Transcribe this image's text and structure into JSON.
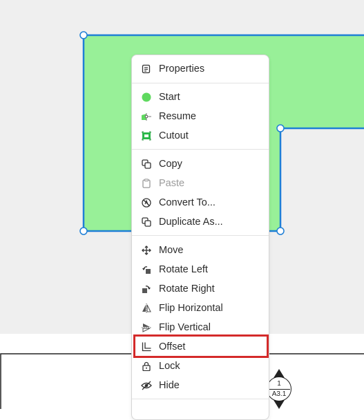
{
  "colors": {
    "shape_fill": "#98f098",
    "shape_stroke": "#1e7fd6",
    "highlight": "#d42a2a",
    "canvas_bg": "#efefef"
  },
  "context_menu": {
    "items": [
      {
        "id": "properties",
        "label": "Properties",
        "icon": "properties-icon",
        "enabled": true
      },
      {
        "id": "start",
        "label": "Start",
        "icon": "start-icon",
        "enabled": true
      },
      {
        "id": "resume",
        "label": "Resume",
        "icon": "resume-icon",
        "enabled": true
      },
      {
        "id": "cutout",
        "label": "Cutout",
        "icon": "cutout-icon",
        "enabled": true
      },
      {
        "id": "copy",
        "label": "Copy",
        "icon": "copy-icon",
        "enabled": true
      },
      {
        "id": "paste",
        "label": "Paste",
        "icon": "paste-icon",
        "enabled": false
      },
      {
        "id": "convert",
        "label": "Convert To...",
        "icon": "convert-icon",
        "enabled": true
      },
      {
        "id": "duplicate",
        "label": "Duplicate As...",
        "icon": "duplicate-icon",
        "enabled": true
      },
      {
        "id": "move",
        "label": "Move",
        "icon": "move-icon",
        "enabled": true
      },
      {
        "id": "rotate_left",
        "label": "Rotate Left",
        "icon": "rotate-left-icon",
        "enabled": true
      },
      {
        "id": "rotate_right",
        "label": "Rotate Right",
        "icon": "rotate-right-icon",
        "enabled": true
      },
      {
        "id": "flip_horizontal",
        "label": "Flip Horizontal",
        "icon": "flip-horizontal-icon",
        "enabled": true
      },
      {
        "id": "flip_vertical",
        "label": "Flip Vertical",
        "icon": "flip-vertical-icon",
        "enabled": true
      },
      {
        "id": "offset",
        "label": "Offset",
        "icon": "offset-icon",
        "enabled": true,
        "highlighted": true
      },
      {
        "id": "lock",
        "label": "Lock",
        "icon": "lock-icon",
        "enabled": true
      },
      {
        "id": "hide",
        "label": "Hide",
        "icon": "hide-icon",
        "enabled": true
      }
    ]
  },
  "section_callout": {
    "number": "1",
    "sheet": "A3.1"
  }
}
